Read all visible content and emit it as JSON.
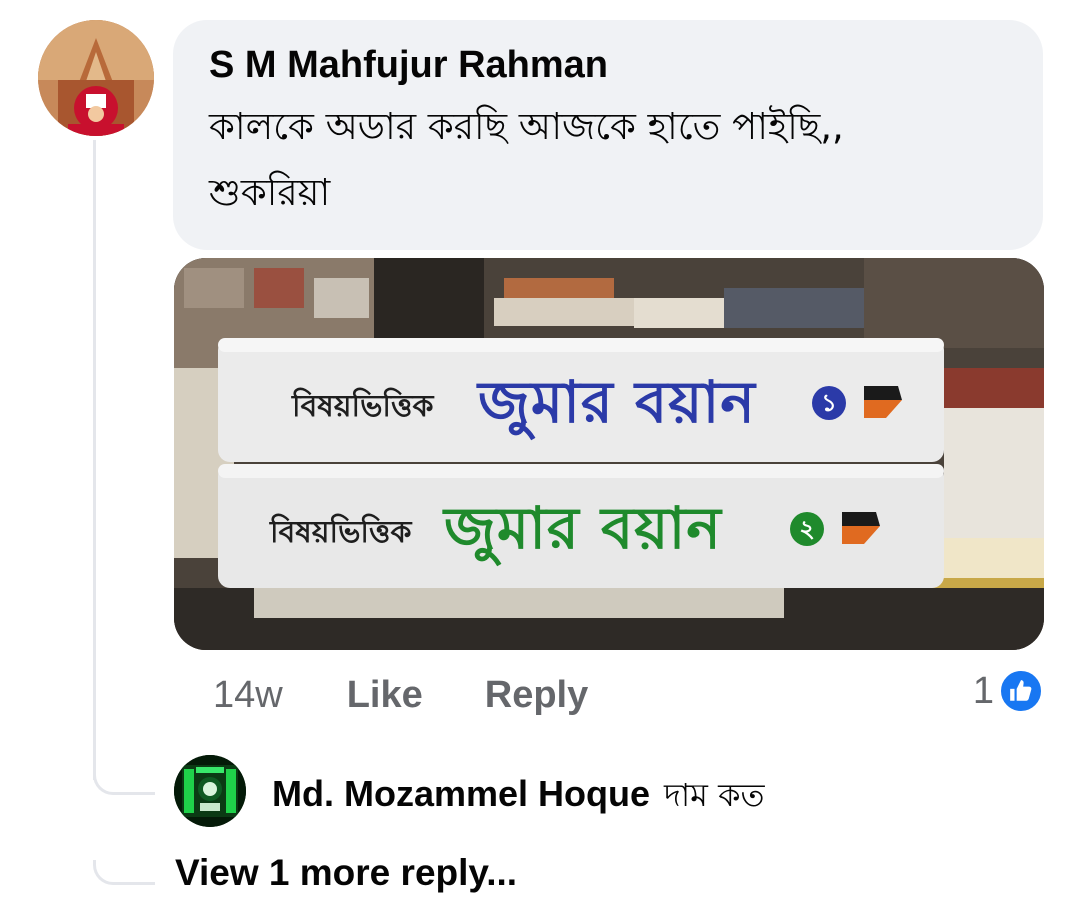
{
  "comment": {
    "author": "S M Mahfujur Rahman",
    "text": "কালকে অডার করছি আজকে হাতে পাইছি,, শুকরিয়া",
    "avatar_icon": "user-avatar-icon",
    "photo": {
      "book_top": {
        "prefix": "বিষয়ভিত্তিক",
        "title": "জুমার বয়ান",
        "number": "১",
        "color": "#2b3aa8"
      },
      "book_bottom": {
        "prefix": "বিষয়ভিত্তিক",
        "title": "জুমার বয়ান",
        "number": "২",
        "color": "#1f8a2c"
      }
    },
    "time": "14w",
    "like_label": "Like",
    "reply_label": "Reply",
    "reaction_count": "1",
    "reaction_icon": "thumbs-up-icon",
    "like_color": "#1877f2"
  },
  "reply": {
    "author": "Md. Mozammel Hoque",
    "text": "দাম কত",
    "avatar_icon": "user-avatar-icon"
  },
  "view_more_label": "View 1 more reply..."
}
